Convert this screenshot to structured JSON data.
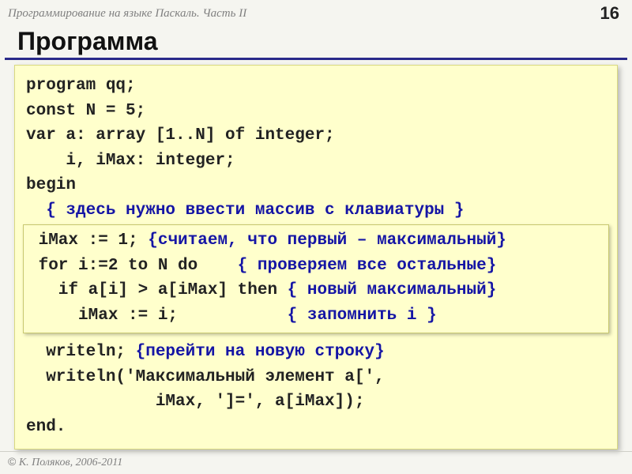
{
  "header": {
    "title": "Программирование на языке Паскаль. Часть II",
    "page": "16"
  },
  "slideTitle": "Программа",
  "code": {
    "l1": "program qq;",
    "l2": "const N = 5;",
    "l3": "var a: array [1..N] of integer;",
    "l4": "    i, iMax: integer;",
    "l5": "begin",
    "l6": "  { здесь нужно ввести массив с клавиатуры }",
    "box": {
      "b1a": " iMax := 1; ",
      "b1c": "{считаем, что первый – максимальный}",
      "b2a": " for i:=2 to N do    ",
      "b2c": "{ проверяем все остальные}",
      "b3a": "   if a[i] > a[iMax] then ",
      "b3c": "{ новый максимальный}",
      "b4a": "     iMax := i;           ",
      "b4c": "{ запомнить i }"
    },
    "l7a": "  writeln; ",
    "l7c": "{перейти на новую строку}",
    "l8": "  writeln('Максимальный элемент a[',",
    "l9": "             iMax, ']=', a[iMax]);",
    "l10": "end."
  },
  "footer": {
    "copy": "©",
    "text": " К. Поляков, 2006-2011"
  }
}
